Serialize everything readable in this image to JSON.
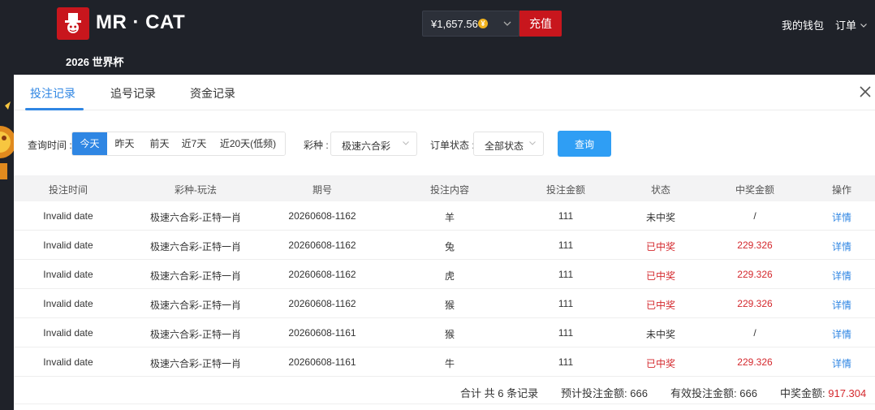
{
  "header": {
    "brand": "MR · CAT",
    "balance": "¥1,657.56",
    "coin_symbol": "¥",
    "recharge_label": "充值",
    "wallet_label": "我的钱包",
    "orders_label": "订单",
    "subnav_label": "2026 世界杯"
  },
  "tabs": [
    {
      "label": "投注记录",
      "active": true
    },
    {
      "label": "追号记录",
      "active": false
    },
    {
      "label": "资金记录",
      "active": false
    }
  ],
  "filters": {
    "time_label": "查询时间 :",
    "date_options": [
      "今天",
      "昨天",
      "前天",
      "近7天",
      "近20天(低频)"
    ],
    "date_selected": "今天",
    "lottery_label": "彩种 :",
    "lottery_value": "极速六合彩",
    "status_label": "订单状态 :",
    "status_value": "全部状态",
    "query_label": "查询"
  },
  "table": {
    "columns": [
      "投注时间",
      "彩种-玩法",
      "期号",
      "投注内容",
      "投注金额",
      "状态",
      "中奖金额",
      "操作"
    ],
    "rows": [
      {
        "time": "Invalid date",
        "game": "极速六合彩-正特一肖",
        "period": "20260608-1162",
        "content": "羊",
        "amount": "111",
        "status": "未中奖",
        "won": false,
        "prize": "/",
        "action": "详情"
      },
      {
        "time": "Invalid date",
        "game": "极速六合彩-正特一肖",
        "period": "20260608-1162",
        "content": "兔",
        "amount": "111",
        "status": "已中奖",
        "won": true,
        "prize": "229.326",
        "action": "详情"
      },
      {
        "time": "Invalid date",
        "game": "极速六合彩-正特一肖",
        "period": "20260608-1162",
        "content": "虎",
        "amount": "111",
        "status": "已中奖",
        "won": true,
        "prize": "229.326",
        "action": "详情"
      },
      {
        "time": "Invalid date",
        "game": "极速六合彩-正特一肖",
        "period": "20260608-1162",
        "content": "猴",
        "amount": "111",
        "status": "已中奖",
        "won": true,
        "prize": "229.326",
        "action": "详情"
      },
      {
        "time": "Invalid date",
        "game": "极速六合彩-正特一肖",
        "period": "20260608-1161",
        "content": "猴",
        "amount": "111",
        "status": "未中奖",
        "won": false,
        "prize": "/",
        "action": "详情"
      },
      {
        "time": "Invalid date",
        "game": "极速六合彩-正特一肖",
        "period": "20260608-1161",
        "content": "牛",
        "amount": "111",
        "status": "已中奖",
        "won": true,
        "prize": "229.326",
        "action": "详情"
      }
    ]
  },
  "summary": {
    "total_records": "合计 共 6 条记录",
    "expected_bet_label": "预计投注金额:",
    "expected_bet_value": "666",
    "valid_bet_label": "有效投注金额:",
    "valid_bet_value": "666",
    "prize_label": "中奖金额:",
    "prize_value": "917.304"
  },
  "colors": {
    "brand_red": "#c8161d",
    "accent_blue": "#2f86e3",
    "win_red": "#d4282d",
    "header_bg": "#1f2229"
  }
}
